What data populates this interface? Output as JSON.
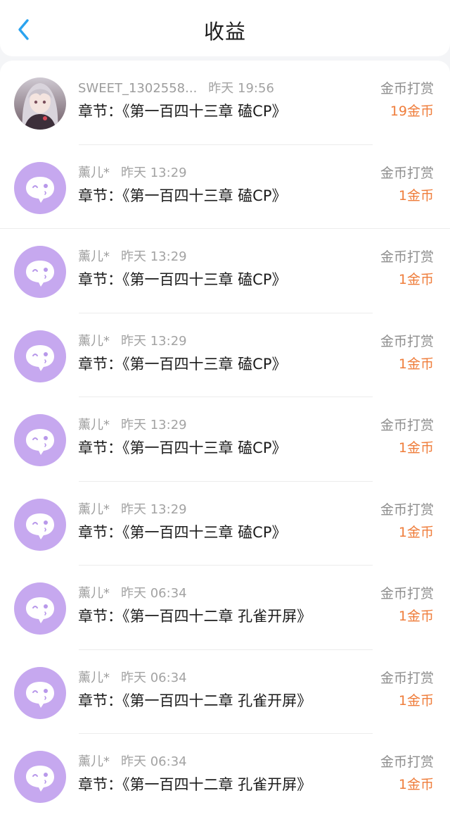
{
  "header": {
    "title": "收益",
    "back_icon": "chevron-left-icon",
    "accent_color": "#2aa3ef"
  },
  "colors": {
    "amount": "#ef7d3b",
    "default_avatar": "#c6a8ef"
  },
  "records": [
    {
      "avatar": "photo",
      "user": "SWEET_1302558...",
      "time": "昨天 19:56",
      "chapter": "章节：《第一百四十三章 磕CP》",
      "type": "金币打赏",
      "amount": "19金币"
    },
    {
      "avatar": "default",
      "user": "薰儿*",
      "time": "昨天 13:29",
      "chapter": "章节：《第一百四十三章 磕CP》",
      "type": "金币打赏",
      "amount": "1金币"
    },
    {
      "avatar": "default",
      "user": "薰儿*",
      "time": "昨天 13:29",
      "chapter": "章节：《第一百四十三章 磕CP》",
      "type": "金币打赏",
      "amount": "1金币"
    },
    {
      "avatar": "default",
      "user": "薰儿*",
      "time": "昨天 13:29",
      "chapter": "章节：《第一百四十三章 磕CP》",
      "type": "金币打赏",
      "amount": "1金币"
    },
    {
      "avatar": "default",
      "user": "薰儿*",
      "time": "昨天 13:29",
      "chapter": "章节：《第一百四十三章 磕CP》",
      "type": "金币打赏",
      "amount": "1金币"
    },
    {
      "avatar": "default",
      "user": "薰儿*",
      "time": "昨天 13:29",
      "chapter": "章节：《第一百四十三章 磕CP》",
      "type": "金币打赏",
      "amount": "1金币"
    },
    {
      "avatar": "default",
      "user": "薰儿*",
      "time": "昨天 06:34",
      "chapter": "章节：《第一百四十二章 孔雀开屏》",
      "type": "金币打赏",
      "amount": "1金币"
    },
    {
      "avatar": "default",
      "user": "薰儿*",
      "time": "昨天 06:34",
      "chapter": "章节：《第一百四十二章 孔雀开屏》",
      "type": "金币打赏",
      "amount": "1金币"
    },
    {
      "avatar": "default",
      "user": "薰儿*",
      "time": "昨天 06:34",
      "chapter": "章节：《第一百四十二章 孔雀开屏》",
      "type": "金币打赏",
      "amount": "1金币"
    }
  ]
}
